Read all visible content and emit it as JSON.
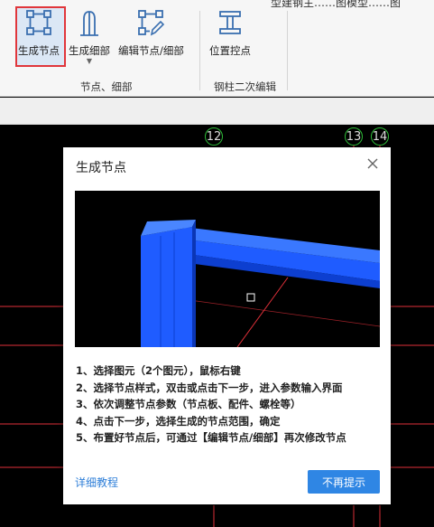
{
  "ribbon": {
    "top_text": "型建钢主……图模型……图",
    "buttons": [
      {
        "label": "生成节点"
      },
      {
        "label": "生成细部"
      },
      {
        "label": "编辑节点/细部"
      },
      {
        "label": "位置控点"
      }
    ],
    "groups": [
      "节点、细部",
      "钢柱二次编辑"
    ]
  },
  "canvas": {
    "axes": [
      "12",
      "13",
      "14"
    ]
  },
  "dialog": {
    "title": "生成节点",
    "steps": [
      "1、选择图元（2个图元），鼠标右键",
      "2、选择节点样式，双击或点击下一步，进入参数输入界面",
      "3、依次调整节点参数（节点板、配件、螺栓等）",
      "4、点击下一步，选择生成的节点范围，确定",
      "5、布置好节点后，可通过【编辑节点/细部】再次修改节点"
    ],
    "tutorial_link": "详细教程",
    "dismiss_button": "不再提示"
  },
  "colors": {
    "accent": "#2f86e4",
    "highlight_border": "#e0363b",
    "axis_circle": "#2fbf3a",
    "canvas_line": "#e0303a",
    "steel_blue": "#1f5cff"
  }
}
